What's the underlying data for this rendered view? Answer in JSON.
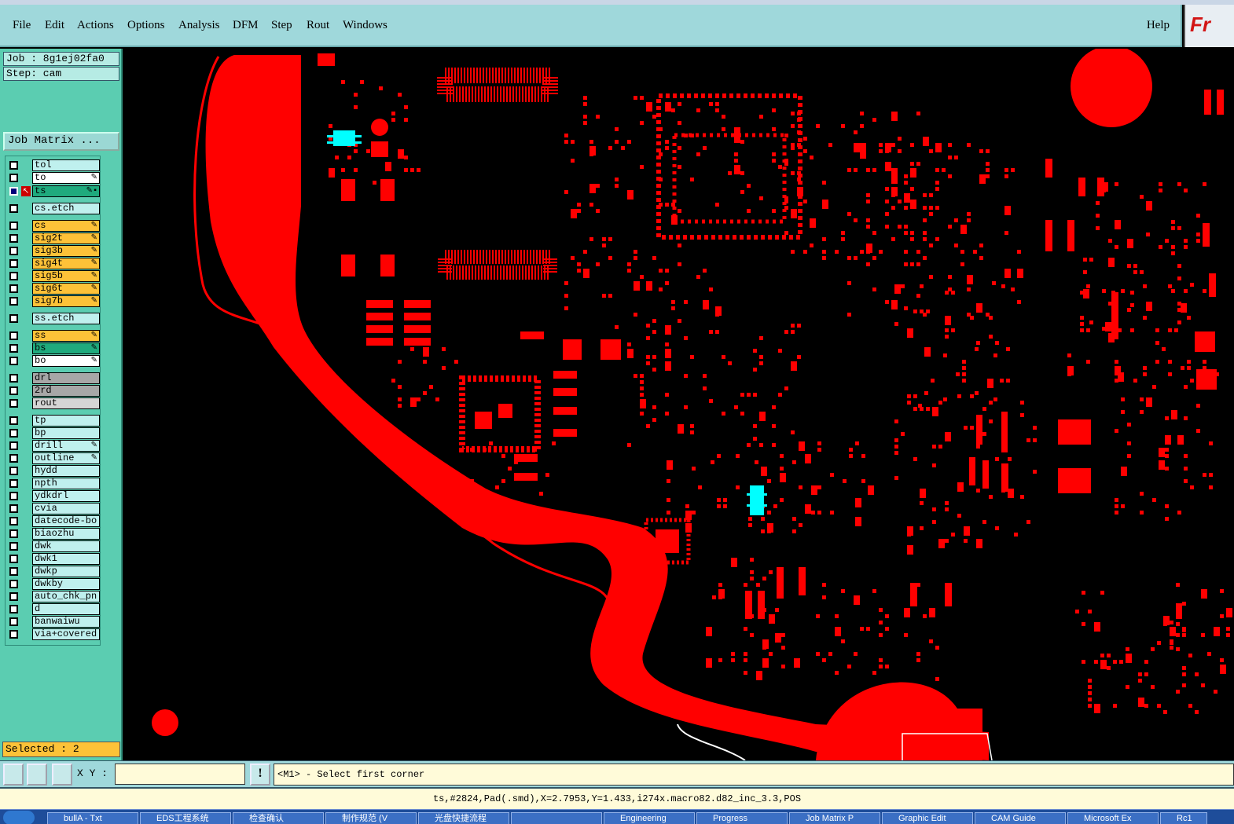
{
  "menubar": {
    "items": [
      "File",
      "Edit",
      "Actions",
      "Options",
      "Analysis",
      "DFM",
      "Step",
      "Rout",
      "Windows"
    ],
    "help": "Help",
    "logo_text": "Fr"
  },
  "side": {
    "job": "Job : 8g1ej02fa0",
    "step": "Step: cam",
    "job_matrix": "Job Matrix ...",
    "selected": "Selected : 2"
  },
  "layers": [
    {
      "name": "tol",
      "color": "cyan",
      "mark": ""
    },
    {
      "name": "to",
      "color": "white",
      "mark": "✎"
    },
    {
      "name": "ts",
      "color": "teal",
      "mark": "✎▪",
      "active": true
    },
    {
      "name": "cs.etch",
      "color": "cyan",
      "mark": ""
    },
    {
      "name": "cs",
      "color": "orange",
      "mark": "✎"
    },
    {
      "name": "sig2t",
      "color": "orange",
      "mark": "✎"
    },
    {
      "name": "sig3b",
      "color": "orange",
      "mark": "✎"
    },
    {
      "name": "sig4t",
      "color": "orange",
      "mark": "✎"
    },
    {
      "name": "sig5b",
      "color": "orange",
      "mark": "✎"
    },
    {
      "name": "sig6t",
      "color": "orange",
      "mark": "✎"
    },
    {
      "name": "sig7b",
      "color": "orange",
      "mark": "✎"
    },
    {
      "name": "ss.etch",
      "color": "cyan",
      "mark": ""
    },
    {
      "name": "ss",
      "color": "orange",
      "mark": "✎"
    },
    {
      "name": "bs",
      "color": "teal",
      "mark": "✎"
    },
    {
      "name": "bo",
      "color": "white",
      "mark": "✎"
    },
    {
      "name": "drl",
      "color": "gray",
      "mark": ""
    },
    {
      "name": "2rd",
      "color": "gray",
      "mark": ""
    },
    {
      "name": "rout",
      "color": "light",
      "mark": ""
    },
    {
      "name": "tp",
      "color": "cyan",
      "mark": ""
    },
    {
      "name": "bp",
      "color": "cyan",
      "mark": ""
    },
    {
      "name": "drill",
      "color": "cyan",
      "mark": "✎"
    },
    {
      "name": "outline",
      "color": "cyan",
      "mark": "✎"
    },
    {
      "name": "hydd",
      "color": "cyan",
      "mark": ""
    },
    {
      "name": "npth",
      "color": "cyan",
      "mark": ""
    },
    {
      "name": "ydkdrl",
      "color": "cyan",
      "mark": ""
    },
    {
      "name": "cvia",
      "color": "cyan",
      "mark": ""
    },
    {
      "name": "datecode-bo",
      "color": "cyan",
      "mark": ""
    },
    {
      "name": "biaozhu",
      "color": "cyan",
      "mark": ""
    },
    {
      "name": "dwk",
      "color": "cyan",
      "mark": ""
    },
    {
      "name": "dwk1",
      "color": "cyan",
      "mark": ""
    },
    {
      "name": "dwkp",
      "color": "cyan",
      "mark": ""
    },
    {
      "name": "dwkby",
      "color": "cyan",
      "mark": ""
    },
    {
      "name": "auto_chk_pn",
      "color": "cyan",
      "mark": ""
    },
    {
      "name": "d",
      "color": "cyan",
      "mark": ""
    },
    {
      "name": "banwaiwu",
      "color": "cyan",
      "mark": ""
    },
    {
      "name": "via+covered",
      "color": "cyan",
      "mark": ""
    }
  ],
  "toolbar": {
    "xy_label": "X Y :",
    "xy_value": "",
    "alert": "!",
    "prompt": "<M1> - Select first corner"
  },
  "status": "ts,#2824,Pad(.smd),X=2.7953,Y=1.433,i274x.macro82.d82_inc_3.3,POS",
  "taskbar": {
    "items": [
      "bullA - Txt",
      "EDS工程系统",
      "检查确认",
      "制作规范 (V",
      "光盘快捷流程",
      "",
      "Engineering",
      "Progress",
      "Job Matrix P",
      "Graphic Edit",
      "CAM Guide",
      "Microsoft Ex",
      "Rc1"
    ]
  },
  "colors": {
    "copper": "#ff0000",
    "selected": "#00ffff",
    "menubar": "#9fd8db",
    "sidebar": "#5bcdb1"
  }
}
